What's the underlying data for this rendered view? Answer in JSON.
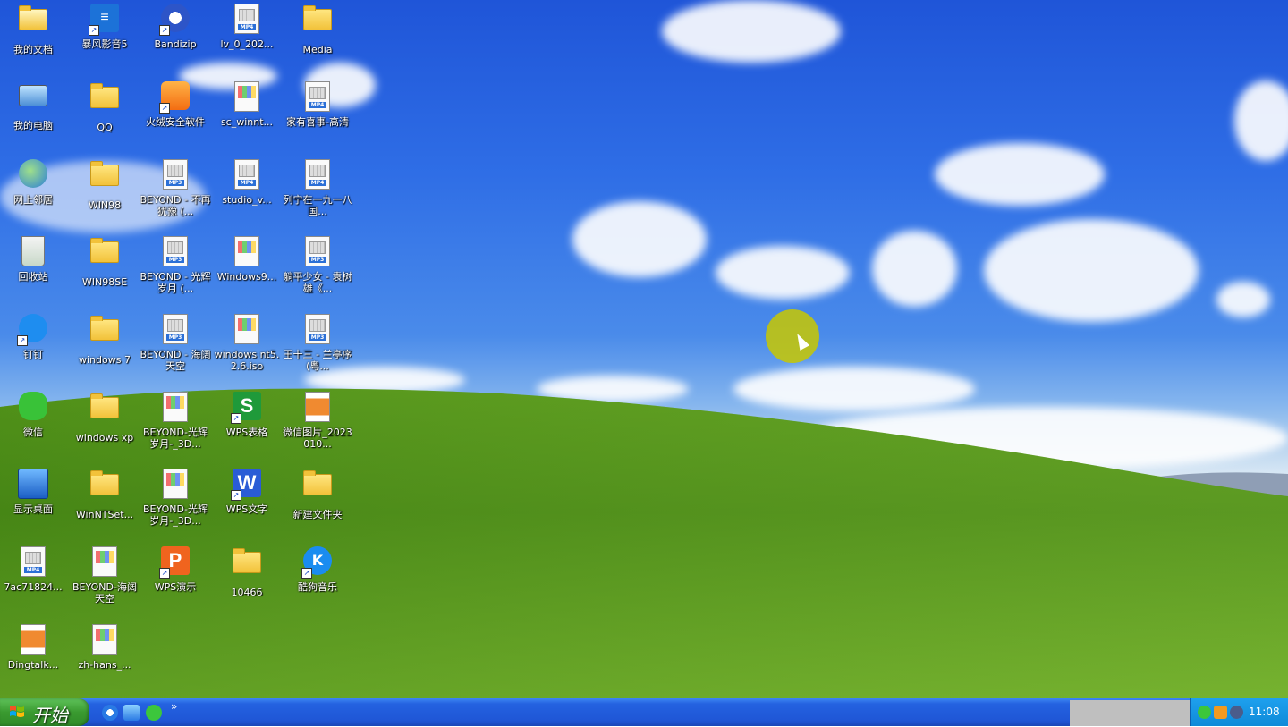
{
  "desktop": {
    "icons": [
      {
        "id": "i1",
        "label": "我的文档"
      },
      {
        "id": "i2",
        "label": "暴风影音5"
      },
      {
        "id": "i3",
        "label": "Bandizip"
      },
      {
        "id": "i4",
        "label": "lv_0_202...",
        "badge": "MP4"
      },
      {
        "id": "i5",
        "label": "Media"
      },
      {
        "id": "i6",
        "label": "我的电脑"
      },
      {
        "id": "i7",
        "label": "QQ"
      },
      {
        "id": "i8",
        "label": "火绒安全软件"
      },
      {
        "id": "i9",
        "label": "sc_winnt..."
      },
      {
        "id": "i10",
        "label": "家有喜事-高清",
        "badge": "MP4"
      },
      {
        "id": "i11",
        "label": "网上邻居"
      },
      {
        "id": "i12",
        "label": "WIN98"
      },
      {
        "id": "i13",
        "label": "BEYOND - 不再犹豫 (...",
        "badge": "MP3"
      },
      {
        "id": "i14",
        "label": "studio_v...",
        "badge": "MP4"
      },
      {
        "id": "i15",
        "label": "列宁在一九一八 国...",
        "badge": "MP4"
      },
      {
        "id": "i16",
        "label": "回收站"
      },
      {
        "id": "i17",
        "label": "WIN98SE"
      },
      {
        "id": "i18",
        "label": "BEYOND - 光辉岁月 (...",
        "badge": "MP3"
      },
      {
        "id": "i19",
        "label": "Windows9..."
      },
      {
        "id": "i20",
        "label": "躺平少女 - 袁树雄《...",
        "badge": "MP3"
      },
      {
        "id": "i21",
        "label": "钉钉"
      },
      {
        "id": "i22",
        "label": "windows 7"
      },
      {
        "id": "i23",
        "label": "BEYOND - 海阔天空",
        "badge": "MP3"
      },
      {
        "id": "i24",
        "label": "windows nt5.2.6.iso"
      },
      {
        "id": "i25",
        "label": "王十三 - 兰亭序 (粤...",
        "badge": "MP3"
      },
      {
        "id": "i26",
        "label": "微信"
      },
      {
        "id": "i27",
        "label": "windows xp"
      },
      {
        "id": "i28",
        "label": "BEYOND-光辉岁月-_3D..."
      },
      {
        "id": "i29",
        "label": "WPS表格"
      },
      {
        "id": "i30",
        "label": "微信图片_2023010..."
      },
      {
        "id": "i31",
        "label": "显示桌面"
      },
      {
        "id": "i32",
        "label": "WinNTSet..."
      },
      {
        "id": "i33",
        "label": "BEYOND-光辉岁月-_3D..."
      },
      {
        "id": "i34",
        "label": "WPS文字"
      },
      {
        "id": "i35",
        "label": "新建文件夹"
      },
      {
        "id": "i36",
        "label": "7ac71824...",
        "badge": "MP4"
      },
      {
        "id": "i37",
        "label": "BEYOND-海阔天空"
      },
      {
        "id": "i38",
        "label": "WPS演示"
      },
      {
        "id": "i39",
        "label": "10466"
      },
      {
        "id": "i40",
        "label": "酷狗音乐"
      },
      {
        "id": "i41",
        "label": "Dingtalk..."
      },
      {
        "id": "i42",
        "label": "zh-hans_..."
      }
    ]
  },
  "taskbar": {
    "start_label": "开始",
    "quicklaunch_more": "»",
    "clock": "11:08"
  }
}
